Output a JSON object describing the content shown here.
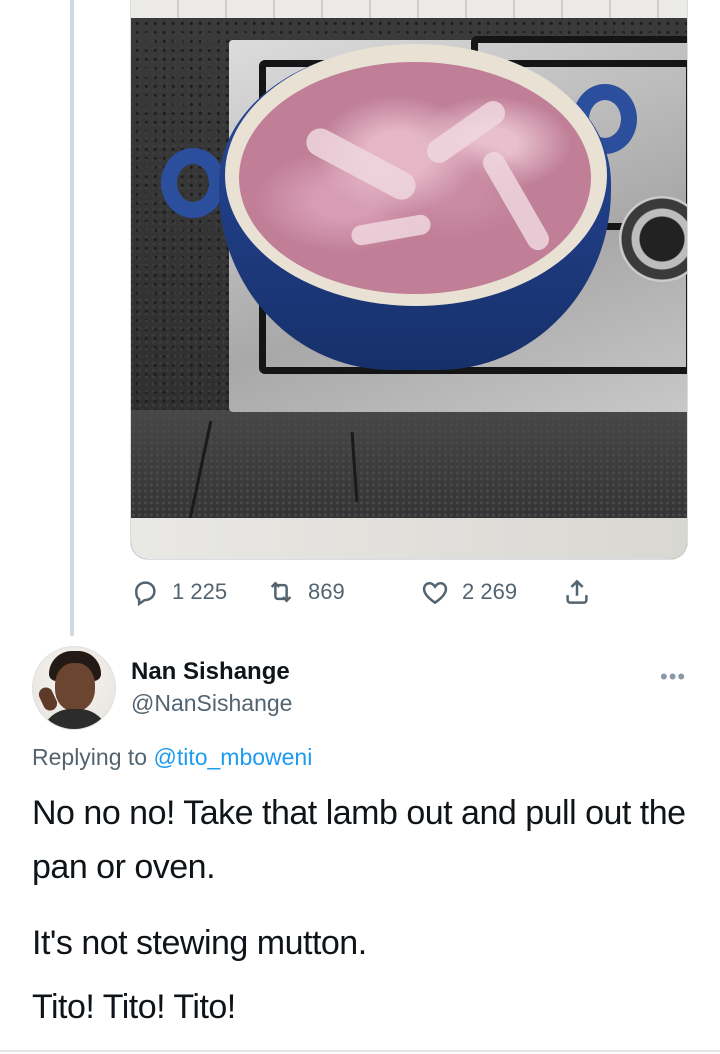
{
  "tweet_actions": {
    "reply_count": "1 225",
    "retweet_count": "869",
    "like_count": "2 269"
  },
  "reply": {
    "display_name": "Nan Sishange",
    "handle": "@NanSishange",
    "replying_prefix": "Replying to ",
    "replying_to": "@tito_mboweni",
    "paragraphs": [
      "No no no! Take that lamb out and pull out the pan or oven.",
      "It's not stewing mutton.",
      "Tito! Tito! Tito!"
    ]
  },
  "icons": [
    "reply-icon",
    "retweet-icon",
    "like-icon",
    "share-icon",
    "more-icon"
  ],
  "colors": {
    "link": "#1d9bf0",
    "secondary": "#536471",
    "text": "#0f1419"
  }
}
